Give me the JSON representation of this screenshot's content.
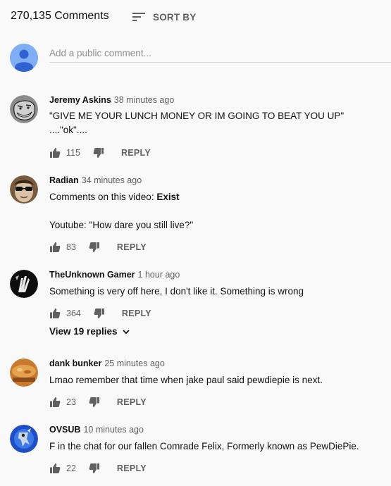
{
  "header": {
    "count_label": "270,135 Comments",
    "sort_label": "SORT BY"
  },
  "composer": {
    "placeholder": "Add a public comment..."
  },
  "reply_label": "REPLY",
  "comments": [
    {
      "author": "Jeremy Askins",
      "time": "38 minutes ago",
      "line1": "\"GIVE ME YOUR LUNCH MONEY OR IM GOING TO BEAT YOU UP\"",
      "line2": "....\"ok\"....",
      "likes": "115"
    },
    {
      "author": "Radian",
      "time": "34 minutes ago",
      "line1_prefix": "Comments on this video: ",
      "line1_bold": "Exist",
      "line3": "Youtube: \"How dare you still live?\"",
      "likes": "83"
    },
    {
      "author": "TheUnknown Gamer",
      "time": "1 hour ago",
      "line1": "Something is very off here, I don't like it. Something is wrong",
      "likes": "364",
      "replies_label": "View 19 replies"
    },
    {
      "author": "dank bunker",
      "time": "25 minutes ago",
      "line1": "Lmao remember that time when jake paul said pewdiepie is next.",
      "likes": "23"
    },
    {
      "author": "OVSUB",
      "time": "10 minutes ago",
      "line1": "F in the chat for our fallen Comrade Felix, Formerly known as PewDiePie.",
      "likes": "22"
    }
  ]
}
